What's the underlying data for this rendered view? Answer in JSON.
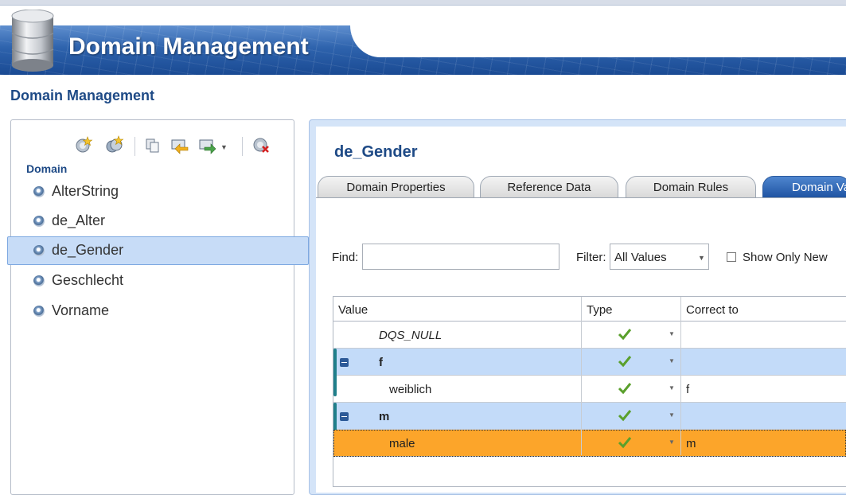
{
  "app": {
    "banner_title": "Domain Management",
    "page_title": "Domain Management"
  },
  "left_panel": {
    "section_header": "Domain",
    "toolbar_icons": [
      "new-domain-icon",
      "new-composite-domain-icon",
      "copy-icon",
      "import-icon",
      "export-icon",
      "delete-domain-icon"
    ],
    "domains": [
      {
        "label": "AlterString",
        "selected": false
      },
      {
        "label": "de_Alter",
        "selected": false
      },
      {
        "label": "de_Gender",
        "selected": true
      },
      {
        "label": "Geschlecht",
        "selected": false
      },
      {
        "label": "Vorname",
        "selected": false
      }
    ]
  },
  "main": {
    "domain_name": "de_Gender",
    "tabs": [
      {
        "label": "Domain Properties",
        "active": false
      },
      {
        "label": "Reference Data",
        "active": false
      },
      {
        "label": "Domain Rules",
        "active": false
      },
      {
        "label": "Domain Values",
        "active": true
      }
    ],
    "find_label": "Find:",
    "find_value": "",
    "filter_label": "Filter:",
    "filter_value": "All Values",
    "show_only_new_label": "Show Only New",
    "show_only_new_checked": false
  },
  "grid": {
    "columns": [
      "Value",
      "Type",
      "Correct to"
    ],
    "rows": [
      {
        "value": "DQS_NULL",
        "type_icon": "valid-check-icon",
        "correct_to": "",
        "kind": "normal"
      },
      {
        "value": "f",
        "type_icon": "valid-check-icon",
        "correct_to": "",
        "kind": "group"
      },
      {
        "value": "weiblich",
        "type_icon": "valid-check-icon",
        "correct_to": "f",
        "kind": "child"
      },
      {
        "value": "m",
        "type_icon": "valid-check-icon",
        "correct_to": "",
        "kind": "group"
      },
      {
        "value": "male",
        "type_icon": "valid-check-icon",
        "correct_to": "m",
        "kind": "selected"
      }
    ]
  },
  "colors": {
    "title_blue": "#1e4a86",
    "selection_orange": "#fca52a",
    "group_blue": "#c3dbf9",
    "tree_selection": "#c7dcf7"
  }
}
